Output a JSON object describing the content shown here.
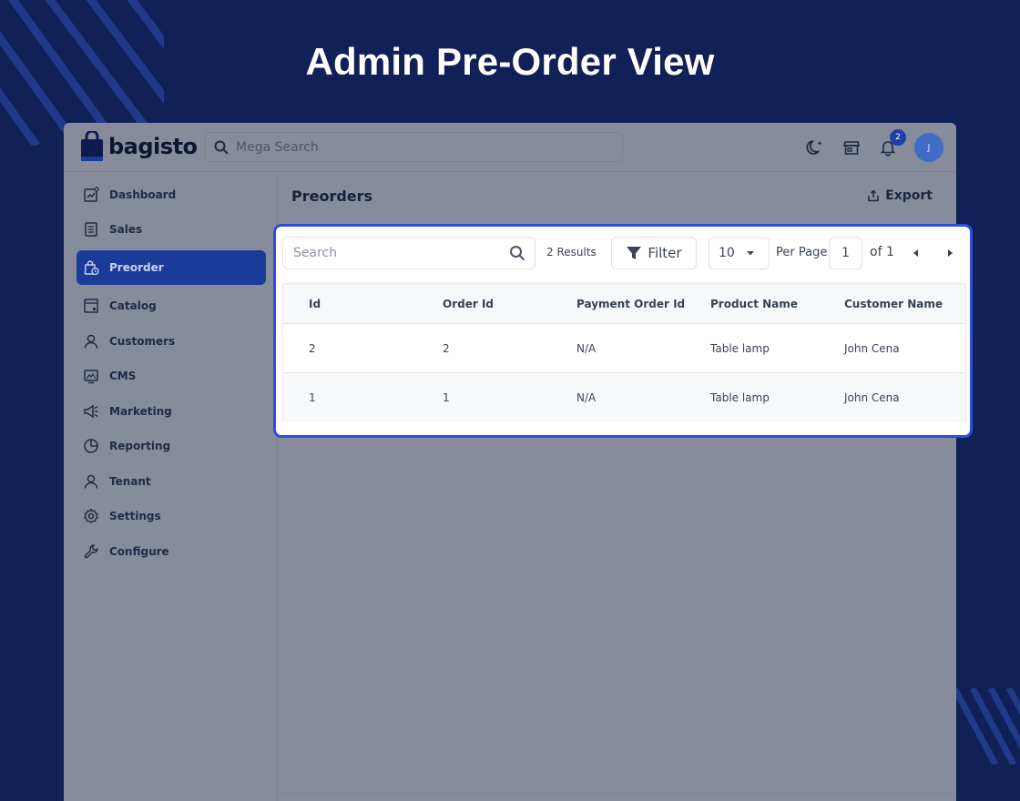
{
  "headline": "Admin Pre-Order View",
  "colors": {
    "background": "#112056",
    "accent": "#2a4fe0",
    "active_nav": "#1a3b98"
  },
  "topbar": {
    "brand": "bagisto",
    "search_placeholder": "Mega Search",
    "notification_count": "2",
    "avatar_initial": "J",
    "icons": [
      "moon-icon",
      "store-icon",
      "bell-icon"
    ]
  },
  "sidebar": {
    "items": [
      {
        "label": "Dashboard",
        "icon": "dashboard-icon",
        "active": false
      },
      {
        "label": "Sales",
        "icon": "receipt-icon",
        "active": false
      },
      {
        "label": "Preorder",
        "icon": "preorder-bag-icon",
        "active": true
      },
      {
        "label": "Catalog",
        "icon": "catalog-icon",
        "active": false
      },
      {
        "label": "Customers",
        "icon": "user-icon",
        "active": false
      },
      {
        "label": "CMS",
        "icon": "monitor-icon",
        "active": false
      },
      {
        "label": "Marketing",
        "icon": "megaphone-icon",
        "active": false
      },
      {
        "label": "Reporting",
        "icon": "pie-chart-icon",
        "active": false
      },
      {
        "label": "Tenant",
        "icon": "user-icon",
        "active": false
      },
      {
        "label": "Settings",
        "icon": "gear-icon",
        "active": false
      },
      {
        "label": "Configure",
        "icon": "wrench-icon",
        "active": false
      }
    ]
  },
  "main": {
    "title": "Preorders",
    "export_label": "Export"
  },
  "datagrid": {
    "search_placeholder": "Search",
    "results": "2 Results",
    "filter_label": "Filter",
    "per_page_value": "10",
    "per_page_label": "Per Page",
    "page_value": "1",
    "of_label": "of 1",
    "columns": [
      "Id",
      "Order Id",
      "Payment Order Id",
      "Product Name",
      "Customer Name"
    ],
    "rows": [
      [
        "2",
        "2",
        "N/A",
        "Table lamp",
        "John Cena"
      ],
      [
        "1",
        "1",
        "N/A",
        "Table lamp",
        "John Cena"
      ]
    ]
  }
}
